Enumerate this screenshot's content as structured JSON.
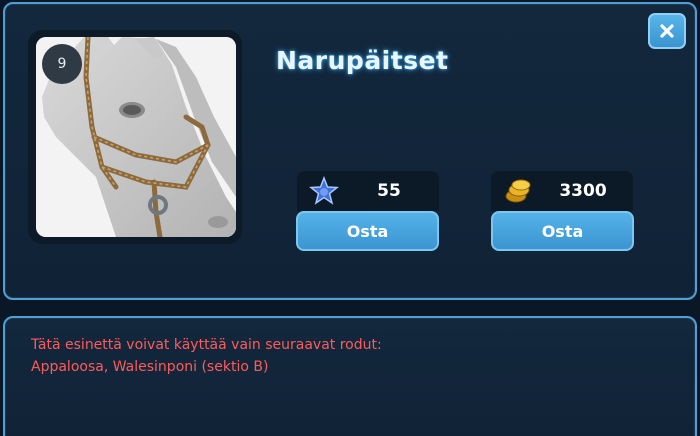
{
  "item": {
    "title": "Narupäitset",
    "level": "9",
    "image": "gray horse head wearing brown rope halter"
  },
  "prices": {
    "star": {
      "icon": "star-icon",
      "value": "55",
      "button_label": "Osta"
    },
    "coins": {
      "icon": "coins-icon",
      "value": "3300",
      "button_label": "Osta"
    }
  },
  "restriction": {
    "line1": "Tätä esinettä voivat käyttää vain seuraavat rodut:",
    "line2": "Appaloosa, Walesinponi (sektio B)"
  },
  "close_icon": "close-icon",
  "colors": {
    "accent": "#4f9fd2",
    "button": "#3b95d0",
    "warning_text": "#ff5a5a",
    "panel_bg": "#13283d"
  }
}
